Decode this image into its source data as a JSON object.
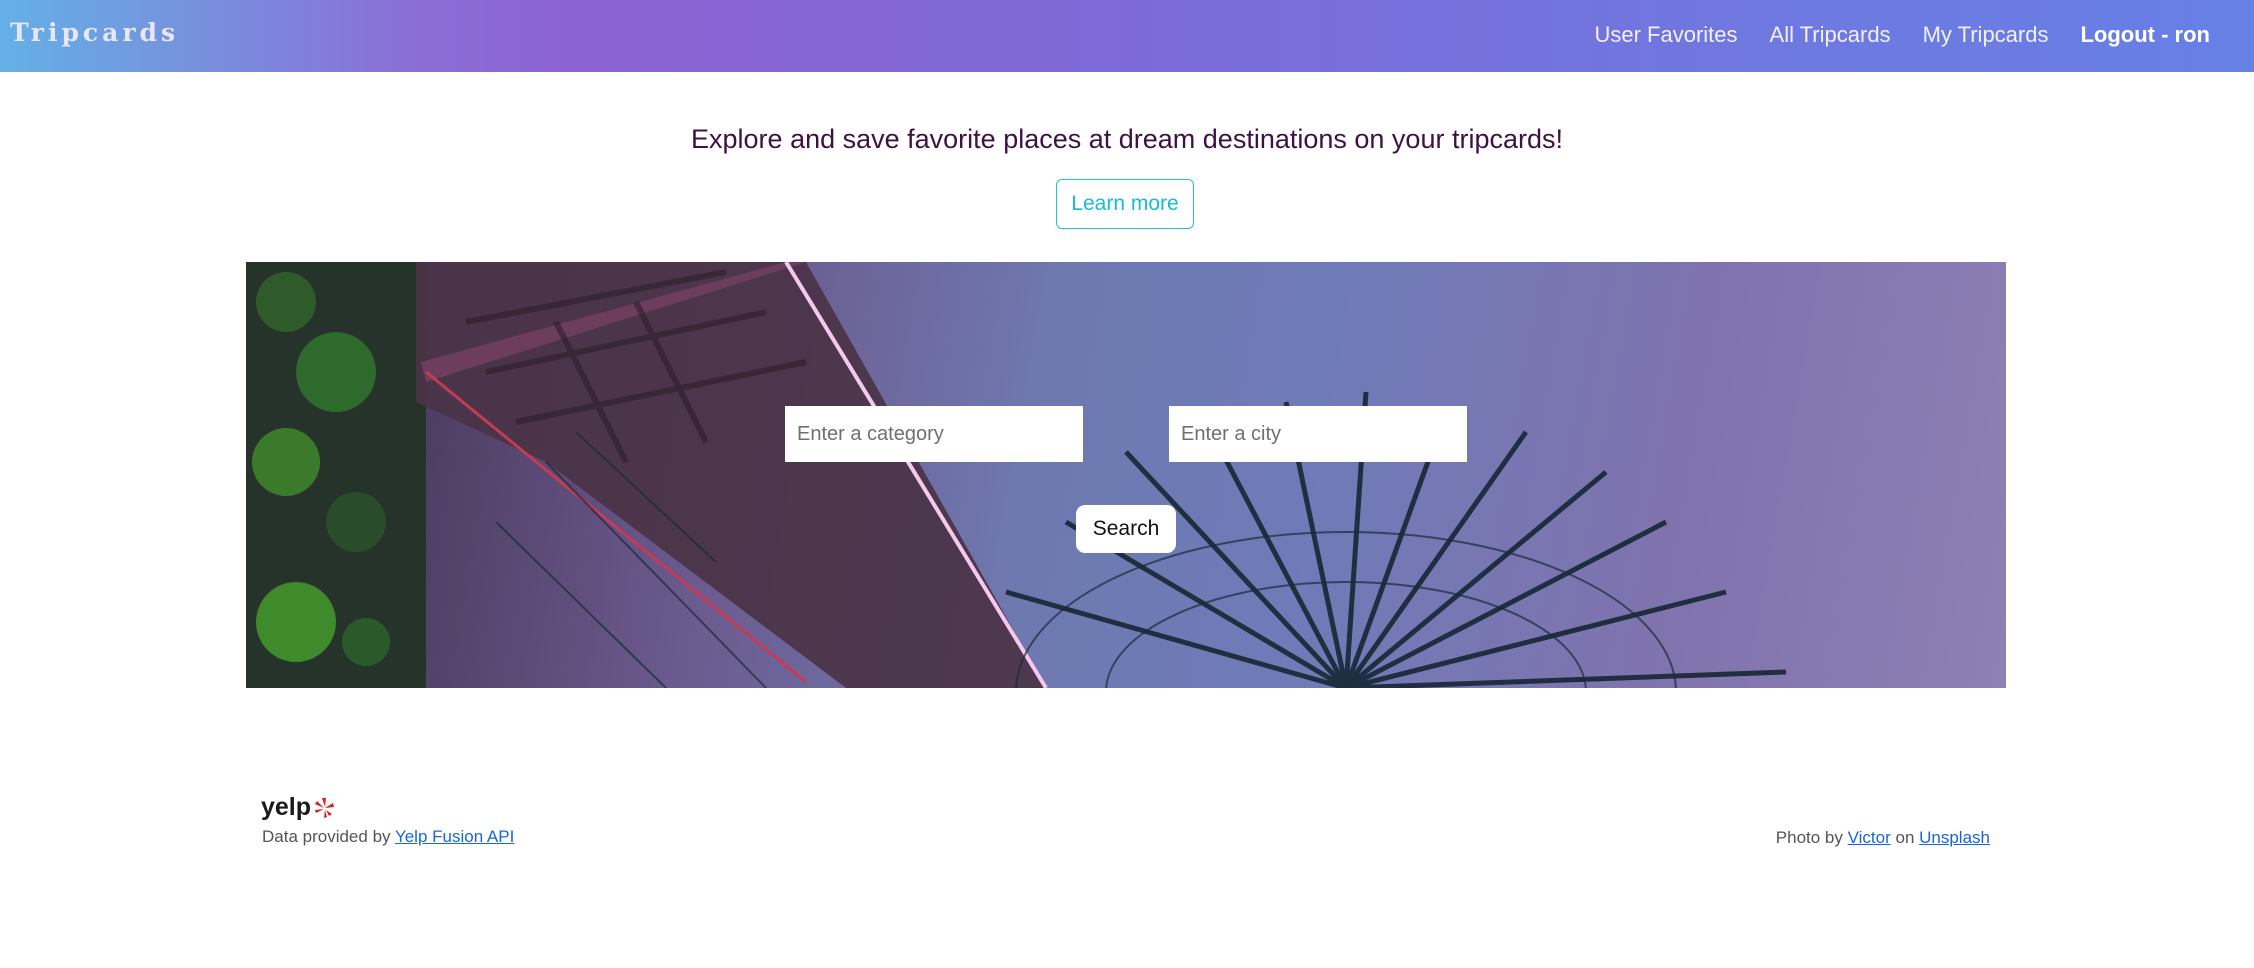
{
  "navbar": {
    "brand": "Tripcards",
    "links": {
      "user_favorites": "User Favorites",
      "all_tripcards": "All Tripcards",
      "my_tripcards": "My Tripcards",
      "logout": "Logout - ron"
    }
  },
  "hero": {
    "tagline": "Explore and save favorite places at dream destinations on your tripcards!",
    "learn_more": "Learn more"
  },
  "search": {
    "category_placeholder": "Enter a category",
    "city_placeholder": "Enter a city",
    "button": "Search"
  },
  "footer": {
    "yelp_logo": "yelp",
    "data_prefix": "Data provided by ",
    "data_link": "Yelp Fusion API",
    "photo_prefix": "Photo by ",
    "photo_author": "Victor",
    "photo_on": " on ",
    "photo_site": "Unsplash"
  },
  "colors": {
    "accent": "#16bcd3",
    "tagline": "#3f1143",
    "link": "#1a66d6",
    "yelp_red": "#d32323"
  }
}
